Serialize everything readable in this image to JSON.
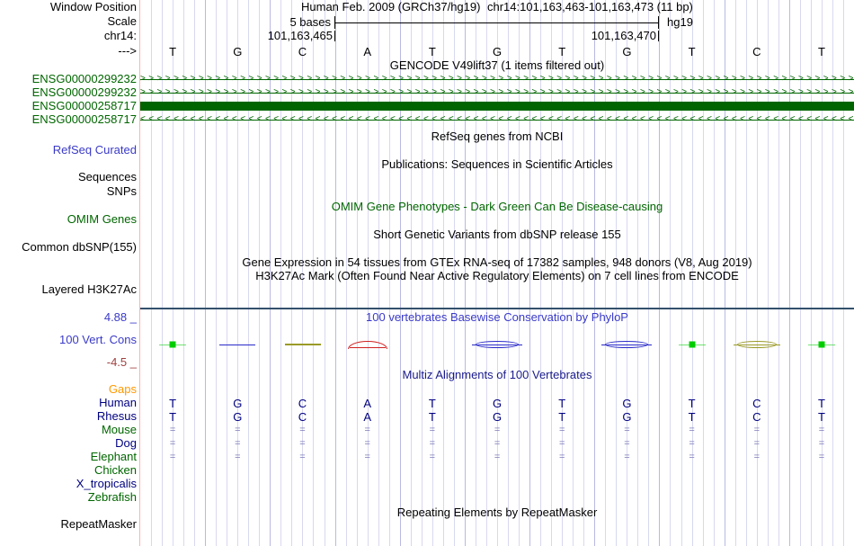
{
  "colors": {
    "gencode_green": "#006400",
    "label_green": "#006600",
    "label_blue": "#3a3ac8",
    "navy": "#000080",
    "maroon": "#a04040",
    "orange": "#ff9900",
    "grid_light": "#d8d8f0",
    "grid_dark": "#b9b9e2",
    "guideline_pink": "#ffb0b0",
    "wiggle_green": "#00cc00",
    "wiggle_blue": "#2a2ac8",
    "wiggle_olive": "#9a9a28",
    "wiggle_red": "#d02020"
  },
  "header": {
    "window_position_label": "Window Position",
    "scale_row_label": "Scale",
    "chrom_label": "chr14:",
    "direction_label": "--->",
    "assembly_title": "Human Feb. 2009 (GRCh37/hg19)",
    "position_title": "chr14:101,163,463-101,163,473 (11 bp)",
    "scale_value": "5 bases",
    "assembly_tag": "hg19",
    "coord_left": "101,163,465",
    "coord_right": "101,163,470"
  },
  "sequence": {
    "bases": [
      "T",
      "G",
      "C",
      "A",
      "T",
      "G",
      "T",
      "G",
      "T",
      "C",
      "T"
    ]
  },
  "gencode": {
    "title": "GENCODE V49lift37 (1 items filtered out)",
    "items": [
      {
        "label": "ENSG00000299232",
        "glyph": "arrows-right"
      },
      {
        "label": "ENSG00000299232",
        "glyph": "arrows-right"
      },
      {
        "label": "ENSG00000258717",
        "glyph": "solid-bar"
      },
      {
        "label": "ENSG00000258717",
        "glyph": "arrows-left"
      }
    ]
  },
  "tracks": {
    "refseq_title": "RefSeq genes from NCBI",
    "refseq_label": "RefSeq Curated",
    "publications_title": "Publications: Sequences in Scientific Articles",
    "sequences_label": "Sequences",
    "snps_label": "SNPs",
    "omim_title": "OMIM Gene Phenotypes - Dark Green Can Be Disease-causing",
    "omim_label": "OMIM Genes",
    "dbsnp_title": "Short Genetic Variants from dbSNP release 155",
    "dbsnp_label": "Common dbSNP(155)",
    "gtex_title": "Gene Expression in 54 tissues from GTEx RNA-seq of 17382 samples, 948 donors (V8, Aug 2019)",
    "h3k27ac_title": "H3K27Ac Mark (Often Found Near Active Regulatory Elements) on 7 cell lines from ENCODE",
    "h3k27ac_label": "Layered H3K27Ac",
    "repeatmasker_title": "Repeating Elements by RepeatMasker",
    "repeatmasker_label": "RepeatMasker"
  },
  "conservation": {
    "title": "100 vertebrates Basewise Conservation by PhyloP",
    "label": "100 Vert. Cons",
    "max_label": "4.88 _",
    "min_label": "-4.5 _",
    "marks": [
      {
        "col": 0,
        "shape": "green-square"
      },
      {
        "col": 1,
        "shape": "blue-line"
      },
      {
        "col": 2,
        "shape": "olive-line"
      },
      {
        "col": 3,
        "shape": "red-arc"
      },
      {
        "col": 5,
        "shape": "blue-lens"
      },
      {
        "col": 7,
        "shape": "blue-lens"
      },
      {
        "col": 8,
        "shape": "green-square"
      },
      {
        "col": 9,
        "shape": "olive-lens"
      },
      {
        "col": 10,
        "shape": "green-square"
      }
    ]
  },
  "multiz": {
    "title": "Multiz Alignments of 100 Vertebrates",
    "rows": [
      {
        "name": "Gaps",
        "color": "orange",
        "cells": []
      },
      {
        "name": "Human",
        "color": "navy",
        "cells": [
          "T",
          "G",
          "C",
          "A",
          "T",
          "G",
          "T",
          "G",
          "T",
          "C",
          "T"
        ]
      },
      {
        "name": "Rhesus",
        "color": "navy",
        "cells": [
          "T",
          "G",
          "C",
          "A",
          "T",
          "G",
          "T",
          "G",
          "T",
          "C",
          "T"
        ]
      },
      {
        "name": "Mouse",
        "color": "green",
        "cells": [
          "=",
          "=",
          "=",
          "=",
          "=",
          "=",
          "=",
          "=",
          "=",
          "=",
          "="
        ]
      },
      {
        "name": "Dog",
        "color": "navy",
        "cells": [
          "=",
          "=",
          "=",
          "=",
          "=",
          "=",
          "=",
          "=",
          "=",
          "=",
          "="
        ]
      },
      {
        "name": "Elephant",
        "color": "green",
        "cells": [
          "=",
          "=",
          "=",
          "=",
          "=",
          "=",
          "=",
          "=",
          "=",
          "=",
          "="
        ]
      },
      {
        "name": "Chicken",
        "color": "green",
        "cells": []
      },
      {
        "name": "X_tropicalis",
        "color": "navy",
        "cells": []
      },
      {
        "name": "Zebrafish",
        "color": "green",
        "cells": []
      }
    ]
  }
}
